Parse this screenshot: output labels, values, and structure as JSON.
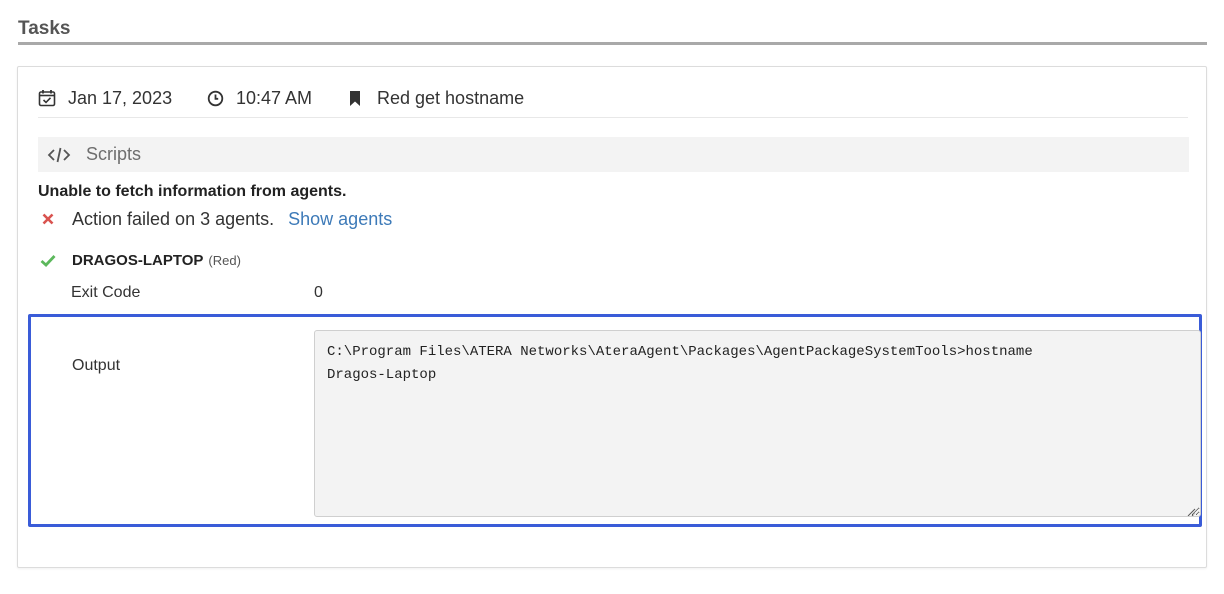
{
  "header": {
    "title": "Tasks"
  },
  "task": {
    "date": "Jan 17, 2023",
    "time": "10:47 AM",
    "name": "Red get hostname",
    "icons": {
      "date": "calendar-check-icon",
      "time": "clock-icon",
      "name": "bookmark-icon"
    }
  },
  "scripts": {
    "label": "Scripts",
    "icon": "code-icon"
  },
  "status": {
    "error_title": "Unable to fetch information from agents.",
    "failure_text": "Action failed on 3 agents.",
    "show_agents_link": "Show agents",
    "failure_icon": "x-icon",
    "failure_color": "#d9534f"
  },
  "agent": {
    "name": "DRAGOS-LAPTOP",
    "tag": "(Red)",
    "success_icon": "check-icon",
    "success_color": "#5cb85c",
    "exit_code_label": "Exit Code",
    "exit_code_value": "0",
    "output_label": "Output",
    "output_lines": [
      "C:\\Program Files\\ATERA Networks\\AteraAgent\\Packages\\AgentPackageSystemTools>hostname",
      "Dragos-Laptop"
    ]
  },
  "colors": {
    "link": "#3d7ab8",
    "highlight_border": "#3a5cd8",
    "header_underline": "#a9a9a9"
  }
}
